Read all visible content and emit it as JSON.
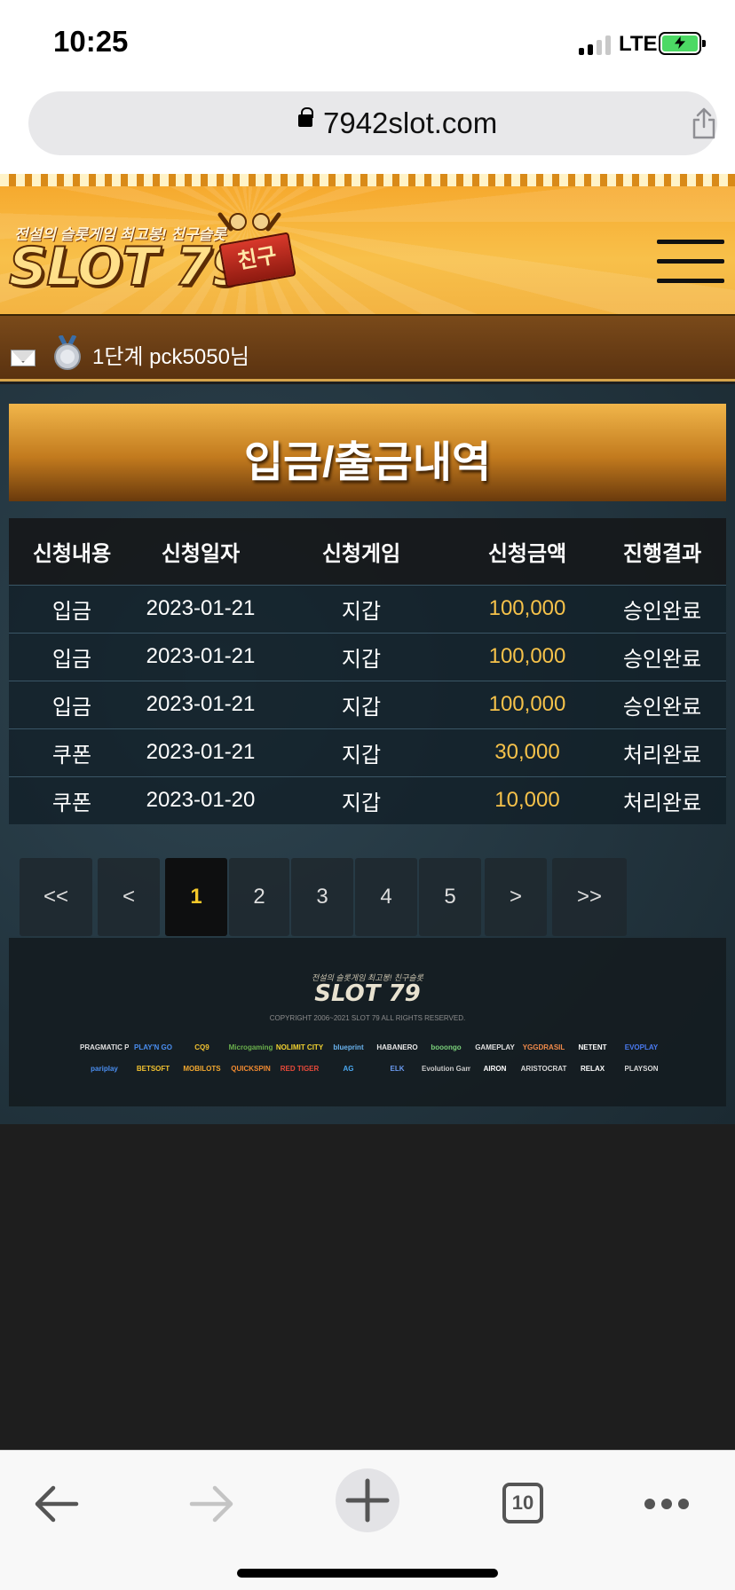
{
  "status_bar": {
    "time": "10:25",
    "network": "LTE"
  },
  "browser": {
    "url": "7942slot.com",
    "tab_count": "10"
  },
  "site": {
    "logo_tagline": "전설의 슬롯게임 최고봉! 친구슬롯",
    "logo_text": "SLOT 79",
    "logo_badge": "친구",
    "user_text": "1단계 pck5050님",
    "page_title": "입금/출금내역"
  },
  "table": {
    "headers": [
      "신청내용",
      "신청일자",
      "신청게임",
      "신청금액",
      "진행결과"
    ],
    "rows": [
      {
        "type": "입금",
        "date": "2023-01-21",
        "game": "지갑",
        "amount": "100,000",
        "status": "승인완료"
      },
      {
        "type": "입금",
        "date": "2023-01-21",
        "game": "지갑",
        "amount": "100,000",
        "status": "승인완료"
      },
      {
        "type": "입금",
        "date": "2023-01-21",
        "game": "지갑",
        "amount": "100,000",
        "status": "승인완료"
      },
      {
        "type": "쿠폰",
        "date": "2023-01-21",
        "game": "지갑",
        "amount": "30,000",
        "status": "처리완료"
      },
      {
        "type": "쿠폰",
        "date": "2023-01-20",
        "game": "지갑",
        "amount": "10,000",
        "status": "처리완료"
      }
    ]
  },
  "pagination": {
    "first": "<<",
    "prev": "<",
    "next": ">",
    "last": ">>",
    "pages": [
      "1",
      "2",
      "3",
      "4",
      "5"
    ],
    "current": "1"
  },
  "footer": {
    "tagline": "전설의 슬롯게임 최고봉! 친구슬롯",
    "logo": "SLOT 79",
    "copyright": "COPYRIGHT 2006~2021 SLOT 79 ALL RIGHTS RESERVED.",
    "providers": [
      "PRAGMATIC PLAY",
      "PLAY'N GO",
      "CQ9",
      "Microgaming",
      "NOLIMIT CITY",
      "blueprint",
      "HABANERO",
      "booongo",
      "GAMEPLAY",
      "YGGDRASIL",
      "NETENT",
      "EVOPLAY",
      "pariplay",
      "BETSOFT",
      "MOBILOTS",
      "QUICKSPIN",
      "RED TIGER",
      "AG",
      "ELK",
      "Evolution Gaming",
      "AIRON",
      "ARISTOCRAT",
      "RELAX",
      "PLAYSON"
    ]
  },
  "colors": {
    "accent_gold": "#f6c24a",
    "active_page": "#f4c82a",
    "header_orange": "#f6a62a"
  }
}
